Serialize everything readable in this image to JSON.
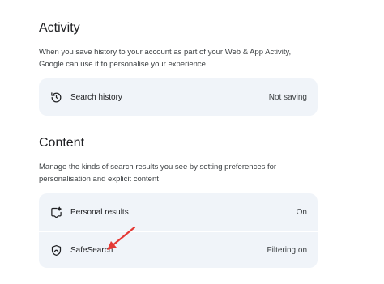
{
  "activity": {
    "title": "Activity",
    "description": "When you save history to your account as part of your Web & App Activity, Google can use it to personalise your experience",
    "items": [
      {
        "label": "Search history",
        "value": "Not saving",
        "icon": "history-icon"
      }
    ]
  },
  "content": {
    "title": "Content",
    "description": "Manage the kinds of search results you see by setting preferences for personalisation and explicit content",
    "items": [
      {
        "label": "Personal results",
        "value": "On",
        "icon": "sparkle-person-icon"
      },
      {
        "label": "SafeSearch",
        "value": "Filtering on",
        "icon": "shield-icon"
      }
    ]
  },
  "annotation": {
    "color": "#e53935",
    "icon": "red-arrow-annotation"
  }
}
